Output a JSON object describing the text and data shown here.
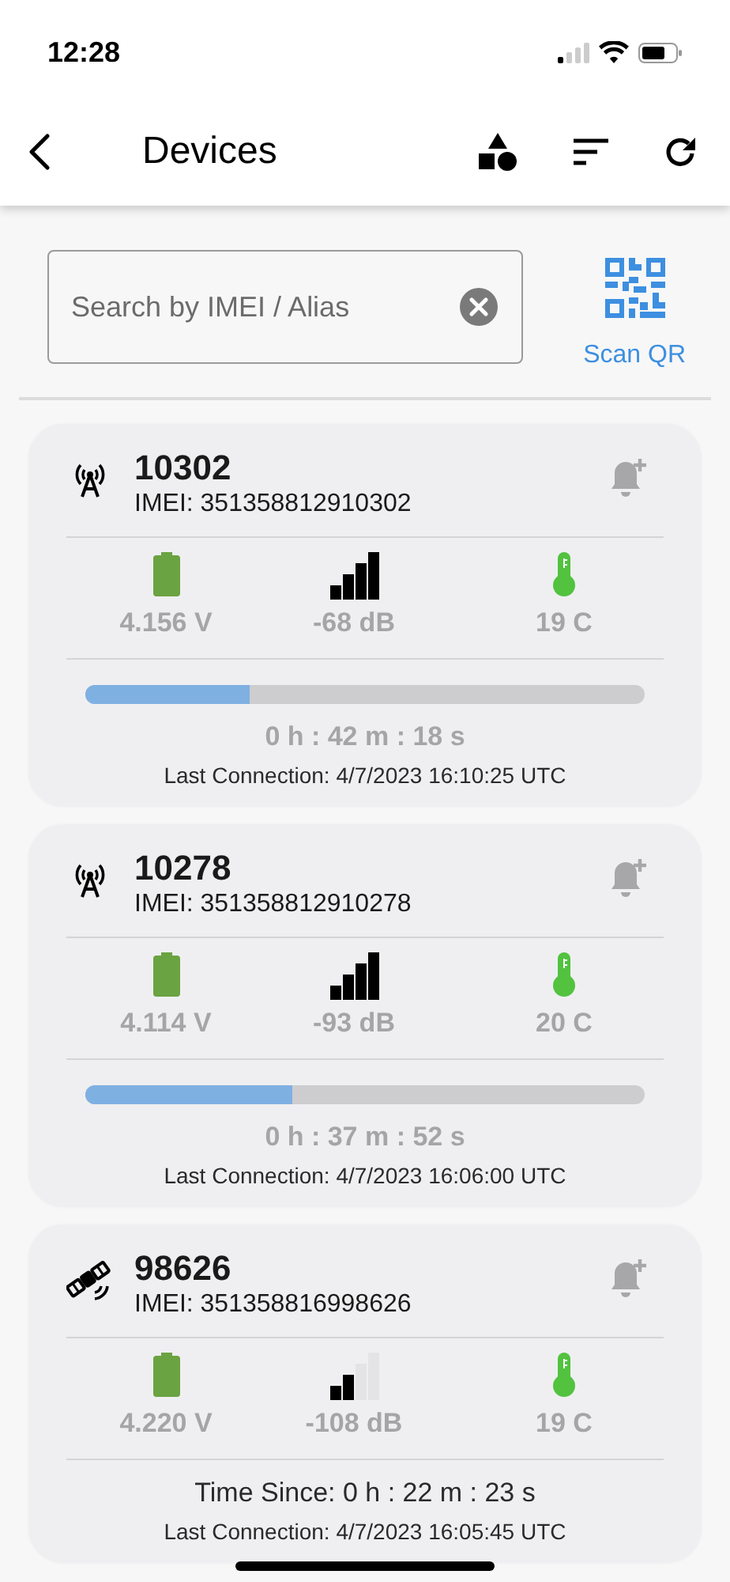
{
  "status_bar": {
    "time": "12:28"
  },
  "header": {
    "title": "Devices"
  },
  "search": {
    "placeholder": "Search by IMEI / Alias"
  },
  "scan_button": {
    "label": "Scan QR"
  },
  "devices": [
    {
      "kind": "cellular",
      "name": "10302",
      "imei": "IMEI: 351358812910302",
      "voltage": "4.156 V",
      "weak_signal": false,
      "signal_reading": "-68 dB",
      "temperature": "19 C",
      "progress": {
        "level": 0.295,
        "elapsed": "0 h : 42 m : 18 s"
      },
      "last_connection": "Last Connection: 4/7/2023 16:10:25 UTC"
    },
    {
      "kind": "cellular",
      "name": "10278",
      "imei": "IMEI: 351358812910278",
      "voltage": "4.114 V",
      "weak_signal": false,
      "signal_reading": "-93 dB",
      "temperature": "20 C",
      "progress": {
        "level": 0.37,
        "elapsed": "0 h : 37 m : 52 s"
      },
      "last_connection": "Last Connection: 4/7/2023 16:06:00 UTC"
    },
    {
      "kind": "satellite",
      "name": "98626",
      "imei": "IMEI: 351358816998626",
      "voltage": "4.220 V",
      "weak_signal": true,
      "signal_reading": "-108 dB",
      "temperature": "19 C",
      "time_since": "Time Since: 0 h : 22 m : 23 s",
      "last_connection": "Last Connection: 4/7/2023 16:05:45 UTC"
    }
  ]
}
